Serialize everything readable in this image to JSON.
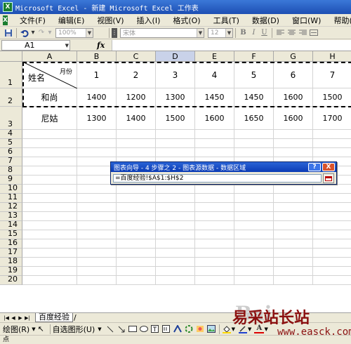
{
  "window": {
    "title": "Microsoft Excel - 新建 Microsoft Excel 工作表",
    "app_icon": "excel-icon"
  },
  "menu": {
    "items": [
      "文件(F)",
      "编辑(E)",
      "视图(V)",
      "插入(I)",
      "格式(O)",
      "工具(T)",
      "数据(D)",
      "窗口(W)",
      "帮助(H)"
    ]
  },
  "toolbar": {
    "zoom": "100%",
    "font": "宋体",
    "font_size": "12",
    "bold": "B",
    "italic": "I",
    "underline": "U"
  },
  "formula_bar": {
    "name_box": "A1",
    "fx": "fx",
    "value": ""
  },
  "columns": [
    "A",
    "B",
    "C",
    "D",
    "E",
    "F",
    "G",
    "H"
  ],
  "selected_column": "D",
  "rows": [
    "1",
    "2",
    "3",
    "4",
    "5",
    "6",
    "7",
    "8",
    "9",
    "10",
    "11",
    "12",
    "13",
    "14",
    "15",
    "16",
    "17",
    "18",
    "19",
    "20"
  ],
  "table": {
    "header_label_top": "月份",
    "header_label_bottom": "姓名",
    "months": [
      "1",
      "2",
      "3",
      "4",
      "5",
      "6",
      "7"
    ],
    "records": [
      {
        "name": "和尚",
        "values": [
          "1400",
          "1200",
          "1300",
          "1450",
          "1450",
          "1600",
          "1500"
        ]
      },
      {
        "name": "尼姑",
        "values": [
          "1300",
          "1400",
          "1500",
          "1600",
          "1650",
          "1600",
          "1700"
        ]
      }
    ]
  },
  "dialog": {
    "title": "图表向导 - 4 步骤之 2 - 图表源数据 - 数据区域",
    "help": "?",
    "close": "X",
    "range": "=百度经验!$A$1:$H$2"
  },
  "sheet_tab": {
    "active": "百度经验"
  },
  "drawing_toolbar": {
    "draw_label": "绘图(R)",
    "autoshape_label": "自选图形(U)"
  },
  "status": {
    "text": "点"
  },
  "watermark": {
    "brand": "易采站长站",
    "url": "www.easck.com"
  },
  "colors": {
    "accent": "#1d4fb3",
    "chrome": "#ece9d8",
    "watermark": "#8b1010"
  }
}
